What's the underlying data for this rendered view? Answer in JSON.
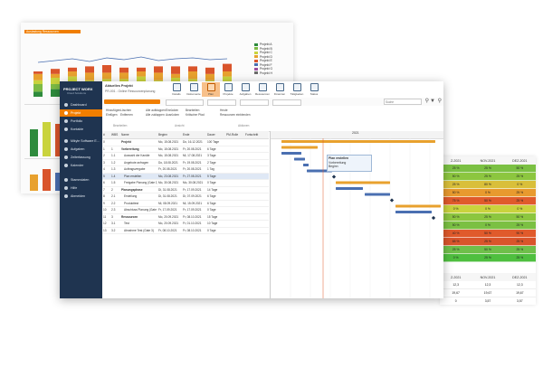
{
  "background_report": {
    "title": "Auslastung Ressourcen",
    "legend": [
      "Projekt A",
      "Projekt B",
      "Projekt C",
      "Projekt D",
      "Projekt E",
      "Projekt F",
      "Projekt G",
      "Projekt H"
    ],
    "colors": [
      "#2e8b3d",
      "#7dbb45",
      "#c9d33d",
      "#e8a12e",
      "#d9542b",
      "#4a6fb1",
      "#9b4fa0",
      "#6b6b6b"
    ]
  },
  "right_table": {
    "headers": [
      "Z-2021",
      "NOV-2021",
      "DEZ-2021"
    ],
    "colored_rows": [
      [
        "25 %",
        "25 %",
        "50 %"
      ],
      [
        "50 %",
        "25 %",
        "25 %"
      ],
      [
        "25 %",
        "80 %",
        "0 %"
      ],
      [
        "50 %",
        "0 %",
        "25 %"
      ],
      [
        "75 %",
        "50 %",
        "25 %"
      ],
      [
        "0 %",
        "0 %",
        "0 %"
      ],
      [
        "50 %",
        "25 %",
        "50 %"
      ],
      [
        "50 %",
        "0 %",
        "25 %"
      ],
      [
        "40 %",
        "50 %",
        "90 %"
      ],
      [
        "65 %",
        "25 %",
        "25 %"
      ],
      [
        "25 %",
        "50 %",
        "25 %"
      ],
      [
        "0 %",
        "25 %",
        "25 %"
      ]
    ],
    "row_colors": [
      "#7bc043",
      "#8cc63f",
      "#d9bf3a",
      "#e89a2e",
      "#e05a2b",
      "#c9d33d",
      "#8cc63f",
      "#7bc043",
      "#e05a2b",
      "#d9542b",
      "#6fbf4a",
      "#4fbf3f"
    ],
    "headers2": [
      "Z-2021",
      "NOV-2021",
      "DEZ-2021"
    ],
    "rows2": [
      [
        "12,3",
        "12,3",
        "12,3"
      ],
      [
        "19,67",
        "19,67",
        "19,67"
      ],
      [
        "0",
        "3,57",
        "3,57"
      ],
      [
        "",
        ""
      ],
      [
        "10",
        "10",
        "10"
      ]
    ]
  },
  "app": {
    "logo": "PROJECT WORX",
    "logo_sub": "Cloud Solutions",
    "nav": [
      {
        "label": "Dashboard"
      },
      {
        "label": "Projekt",
        "active": true
      },
      {
        "label": "Portfolio"
      },
      {
        "label": "Kontakte"
      },
      {
        "label": "Mikyle Software E..."
      },
      {
        "label": "Aufgaben"
      },
      {
        "label": "Zeiterfassung"
      },
      {
        "label": "Kalender"
      },
      {
        "label": "Stammdaten"
      },
      {
        "label": "Hilfe"
      },
      {
        "label": "Abmelden"
      }
    ],
    "project_title": "Aktuelles Projekt",
    "project_name": "PR-001 - Online Ressourcenplanung",
    "toolbar": [
      {
        "label": "Details"
      },
      {
        "label": "Dokumente"
      },
      {
        "label": "Plan",
        "active": true
      },
      {
        "label": "Projekte"
      },
      {
        "label": "Aufgaben"
      },
      {
        "label": "Ressourcen"
      },
      {
        "label": "Finanzen"
      },
      {
        "label": "Tätigkeiten"
      },
      {
        "label": "Status"
      }
    ],
    "search_placeholder": "Suche",
    "ribbon": {
      "groups": [
        "Bearbeiten",
        "Ansicht",
        "Aktionen"
      ],
      "items": [
        "Hinzufügen",
        "Einfügen",
        "Löschen",
        "Entfernen",
        "Alle aufklappen",
        "Alle zuklappen",
        "Einrücken",
        "Ausrücken",
        "Bearbeiten",
        "Kritischer Pfad",
        "Heute",
        "Ressourcen einblenden"
      ]
    },
    "grid": {
      "headers": [
        "#",
        "WBS",
        "Name",
        "Beginn",
        "Ende",
        "Dauer",
        "PM-Rolle",
        "Fortschritt"
      ],
      "rows": [
        [
          "0",
          "",
          "Projekt",
          "Mo, 15.08.2021",
          "Do, 16.12.2021",
          "100 Tage",
          "",
          ""
        ],
        [
          "1",
          "1",
          "Vorbereitung",
          "Mo, 15.08.2021",
          "Fr, 20.08.2021",
          "6 Tage",
          "",
          ""
        ],
        [
          "2",
          "1.1",
          "Auswahl der Kanäle",
          "Mo, 15.08.2021",
          "Mi, 17.08.2021",
          "3 Tage",
          "",
          ""
        ],
        [
          "3",
          "1.2",
          "Angebote anfragen",
          "Do, 18.08.2021",
          "Fr, 19.08.2021",
          "2 Tage",
          "",
          ""
        ],
        [
          "4",
          "1.3",
          "Auftragsvergabe",
          "Fr, 20.08.2021",
          "Fr, 20.08.2021",
          "1 Tag",
          "",
          ""
        ],
        [
          "5",
          "1.4",
          "Plan erstellen",
          "Mo, 23.08.2021",
          "Fr, 27.08.2021",
          "5 Tage",
          "",
          ""
        ],
        [
          "6",
          "1.5",
          "Freigabe Planung (Gate 1)",
          "Mo, 30.08.2021",
          "Mo, 30.08.2021",
          "0 Tage",
          "",
          ""
        ],
        [
          "7",
          "2",
          "Planungsphase",
          "Di, 31.08.2021",
          "Fr, 17.09.2021",
          "14 Tage",
          "",
          ""
        ],
        [
          "8",
          "2.1",
          "Erstellung",
          "Di, 31.08.2021",
          "Di, 07.09.2021",
          "6 Tage",
          "",
          ""
        ],
        [
          "9",
          "2.2",
          "Produkttest",
          "Mi, 08.09.2021",
          "Mi, 15.09.2021",
          "6 Tage",
          "",
          ""
        ],
        [
          "10",
          "2.3",
          "Abschluss Planung (Gate 2)",
          "Fr, 17.09.2021",
          "Fr, 17.09.2021",
          "0 Tage",
          "",
          ""
        ],
        [
          "11",
          "3",
          "Ressourcen",
          "Mo, 20.09.2021",
          "Fr, 08.10.2021",
          "15 Tage",
          "",
          ""
        ],
        [
          "12",
          "3.1",
          "Test",
          "Mo, 20.09.2021",
          "Fr, 01.10.2021",
          "10 Tage",
          "",
          ""
        ],
        [
          "13",
          "3.2",
          "Abnahme Test (Gate 3)",
          "Fr, 08.10.2021",
          "Fr, 08.10.2021",
          "0 Tage",
          "",
          ""
        ]
      ]
    },
    "gantt": {
      "months": [
        "",
        "2021"
      ],
      "tooltip": [
        "Plan erstellen",
        "Vorbereitung",
        "Beginn",
        "Dauer",
        "Ende"
      ]
    }
  }
}
